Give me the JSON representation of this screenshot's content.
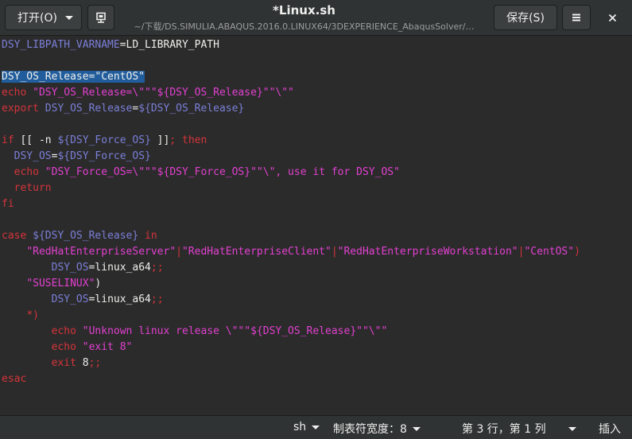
{
  "header": {
    "open_label": "打开(O)",
    "title": "*Linux.sh",
    "subtitle": "~/下载/DS.SIMULIA.ABAQUS.2016.0.LINUX64/3DEXPERIENCE_AbaqusSolver/…",
    "save_label": "保存(S)",
    "menu_glyph": "≡",
    "close_glyph": "✕",
    "pin_icon": "pin-icon"
  },
  "editor": {
    "lines": [
      [
        [
          "var",
          "DSY_LIBPATH_VARNAME"
        ],
        [
          "plain",
          "=LD_LIBRARY_PATH"
        ]
      ],
      [],
      [
        [
          "sel",
          "DSY_OS_Release=\"CentOS\""
        ]
      ],
      [
        [
          "kw",
          "echo "
        ],
        [
          "str",
          "\"DSY_OS_Release=\\\"\""
        ],
        [
          "str",
          "\"${DSY_OS_Release}\""
        ],
        [
          "str",
          "\"\\\"\""
        ]
      ],
      [
        [
          "kw",
          "export "
        ],
        [
          "var",
          "DSY_OS_Release"
        ],
        [
          "plain",
          "="
        ],
        [
          "var",
          "${DSY_OS_Release}"
        ]
      ],
      [],
      [
        [
          "kw",
          "if "
        ],
        [
          "plain",
          "[[ -n "
        ],
        [
          "var",
          "${DSY_Force_OS}"
        ],
        [
          "plain",
          " ]]"
        ],
        [
          "kw",
          "; then"
        ]
      ],
      [
        [
          "plain",
          "  "
        ],
        [
          "var",
          "DSY_OS"
        ],
        [
          "plain",
          "="
        ],
        [
          "var",
          "${DSY_Force_OS}"
        ]
      ],
      [
        [
          "plain",
          "  "
        ],
        [
          "kw",
          "echo "
        ],
        [
          "str",
          "\"DSY_Force_OS=\\\"\""
        ],
        [
          "str",
          "\"${DSY_Force_OS}\""
        ],
        [
          "str",
          "\"\\\", use it for DSY_OS\""
        ]
      ],
      [
        [
          "plain",
          "  "
        ],
        [
          "kw",
          "return"
        ]
      ],
      [
        [
          "kw",
          "fi"
        ]
      ],
      [],
      [
        [
          "kw",
          "case "
        ],
        [
          "var",
          "${DSY_OS_Release}"
        ],
        [
          "kw",
          " in"
        ]
      ],
      [
        [
          "plain",
          "    "
        ],
        [
          "str",
          "\"RedHatEnterpriseServer\""
        ],
        [
          "kw",
          "|"
        ],
        [
          "str",
          "\"RedHatEnterpriseClient\""
        ],
        [
          "kw",
          "|"
        ],
        [
          "str",
          "\"RedHatEnterpriseWorkstation\""
        ],
        [
          "kw",
          "|"
        ],
        [
          "str",
          "\"CentOS\""
        ],
        [
          "kw",
          ")"
        ]
      ],
      [
        [
          "plain",
          "        "
        ],
        [
          "var",
          "DSY_OS"
        ],
        [
          "plain",
          "=linux_a64"
        ],
        [
          "kw",
          ";;"
        ]
      ],
      [
        [
          "plain",
          "    "
        ],
        [
          "str",
          "\"SUSELINUX\""
        ],
        [
          "plain",
          ")"
        ]
      ],
      [
        [
          "plain",
          "        "
        ],
        [
          "var",
          "DSY_OS"
        ],
        [
          "plain",
          "=linux_a64"
        ],
        [
          "kw",
          ";;"
        ]
      ],
      [
        [
          "plain",
          "    "
        ],
        [
          "kw",
          "*)"
        ]
      ],
      [
        [
          "plain",
          "        "
        ],
        [
          "kw",
          "echo "
        ],
        [
          "str",
          "\"Unknown linux release \\\"\""
        ],
        [
          "str",
          "\"${DSY_OS_Release}\""
        ],
        [
          "str",
          "\"\\\"\""
        ]
      ],
      [
        [
          "plain",
          "        "
        ],
        [
          "kw",
          "echo "
        ],
        [
          "str",
          "\"exit 8\""
        ]
      ],
      [
        [
          "plain",
          "        "
        ],
        [
          "kw",
          "exit "
        ],
        [
          "plain",
          "8"
        ],
        [
          "kw",
          ";;"
        ]
      ],
      [
        [
          "kw",
          "esac"
        ]
      ]
    ]
  },
  "statusbar": {
    "language": "sh",
    "tab_width": "制表符宽度：8",
    "position": "第 3 行，第 1 列",
    "mode": "插入"
  }
}
